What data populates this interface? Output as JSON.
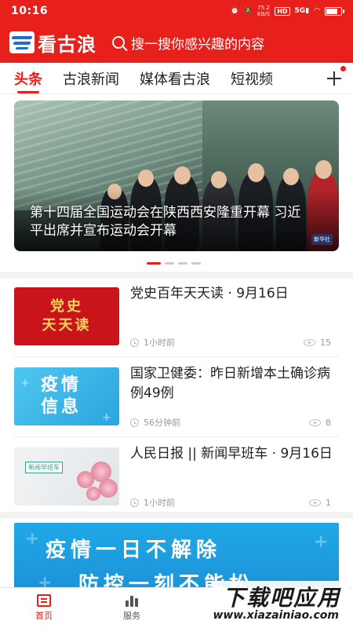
{
  "status_bar": {
    "time": "10:16",
    "net_speed": "75.2",
    "net_unit": "KB/S",
    "hd": "HD",
    "signal": "5G"
  },
  "header": {
    "app_name": "看古浪",
    "search_placeholder": "搜一搜你感兴趣的内容",
    "brand_color": "#e8201c"
  },
  "tabs": [
    {
      "label": "头条",
      "active": true
    },
    {
      "label": "古浪新闻",
      "active": false
    },
    {
      "label": "媒体看古浪",
      "active": false
    },
    {
      "label": "短视频",
      "active": false
    }
  ],
  "banner": {
    "title": "第十四届全国运动会在陕西西安隆重开幕 习近平出席并宣布运动会开幕",
    "mark": "新华社",
    "slide_count": 4,
    "active_slide": 1
  },
  "news": [
    {
      "title": "党史百年天天读 · 9月16日",
      "time": "1小时前",
      "views": "15",
      "thumb_lines": [
        "党史",
        "天天读"
      ]
    },
    {
      "title": "国家卫健委：昨日新增本土确诊病例49例",
      "time": "56分钟前",
      "views": "8",
      "thumb_lines": [
        "疫情",
        "信息"
      ]
    },
    {
      "title": "人民日报 || 新闻早班车 · 9月16日",
      "time": "1小时前",
      "views": "1",
      "thumb_lines": [
        "新闻早班车"
      ]
    }
  ],
  "promo": {
    "line1": "疫情一日不解除",
    "line2": "防控一刻不能松"
  },
  "bottom_nav": [
    {
      "label": "首页",
      "icon": "home-icon",
      "active": true
    },
    {
      "label": "服务",
      "icon": "service-icon",
      "active": false
    }
  ],
  "watermark": {
    "main": "下载吧应用",
    "url": "www.xiazainiao.com"
  }
}
